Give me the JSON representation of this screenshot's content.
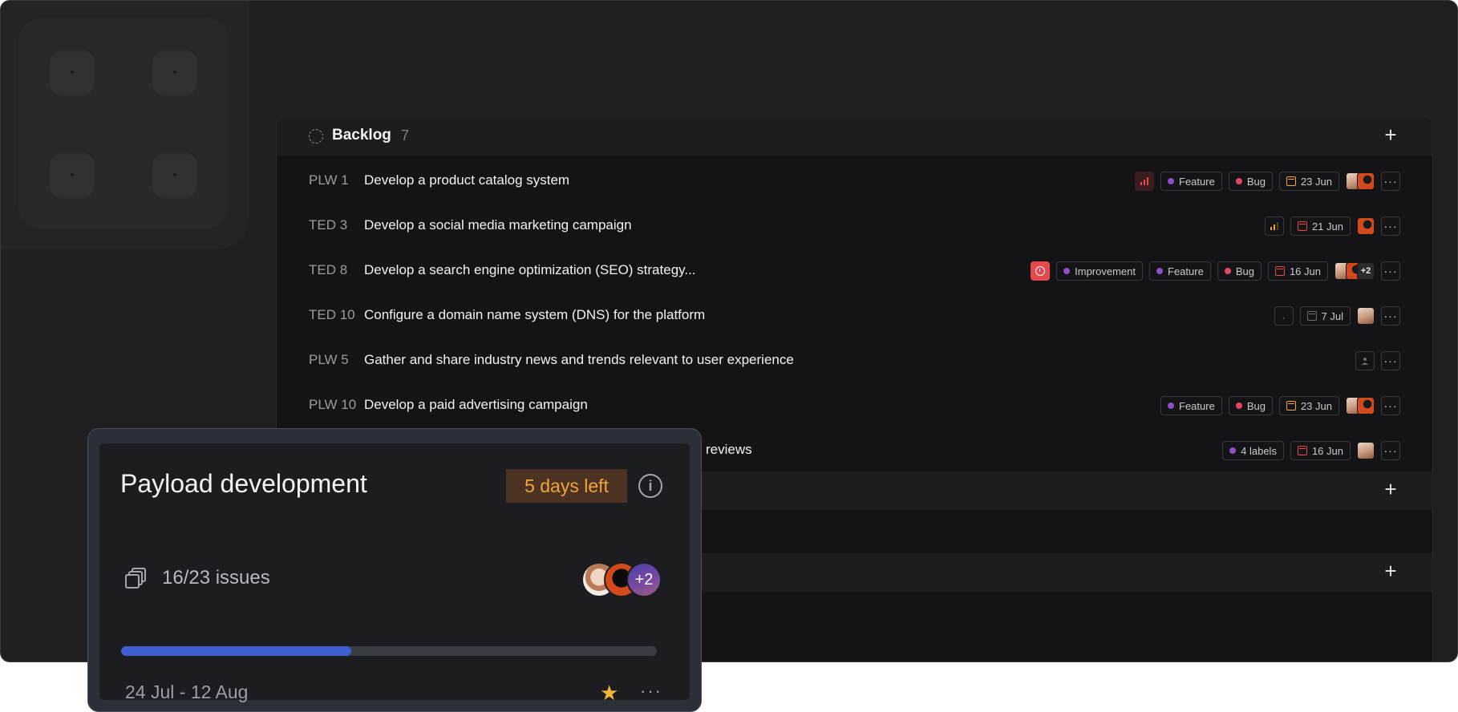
{
  "backlog_group": {
    "title": "Backlog",
    "count": "7"
  },
  "issues": [
    {
      "id": "PLW 1",
      "title": "Develop a product catalog system",
      "labels": [
        "Feature",
        "Bug"
      ],
      "date": "23 Jun"
    },
    {
      "id": "TED 3",
      "title": "Develop a social media marketing campaign",
      "labels": [],
      "date": "21 Jun"
    },
    {
      "id": "TED 8",
      "title": "Develop a search engine optimization (SEO) strategy...",
      "labels": [
        "Improvement",
        "Feature",
        "Bug"
      ],
      "date": "16 Jun",
      "extra_assignees": "+2"
    },
    {
      "id": "TED 10",
      "title": "Configure a domain name system (DNS) for the platform",
      "labels": [],
      "date": "7 Jul"
    },
    {
      "id": "PLW 5",
      "title": "Gather and share industry news and trends relevant to user experience",
      "labels": [],
      "date": ""
    },
    {
      "id": "PLW 10",
      "title": "Develop a paid advertising campaign",
      "labels": [
        "Feature",
        "Bug"
      ],
      "date": "23 Jun"
    },
    {
      "id": "",
      "title": "reviews",
      "labels": [
        "4 labels"
      ],
      "date": "16 Jun"
    }
  ],
  "label_colors": {
    "Feature": "#8e4ec6",
    "Bug": "#e54666",
    "Improvement": "#8e4ec6",
    "4 labels": "#8e4ec6"
  },
  "date_colors": {
    "overdue": "#e5484d",
    "soon": "#f2a33a",
    "future": "#8a8a90"
  },
  "group_add_icon": "plus-icon",
  "cycle_card": {
    "title": "Payload development",
    "days_left": "5 days left",
    "issues": "16/23 issues",
    "progress_percent": 43,
    "assignees_more": "+2",
    "dates": "24 Jul - 12 Aug",
    "favorite_icon": "star-icon",
    "more_icon": "ellipsis-icon",
    "info_icon": "info-icon"
  },
  "colors": {
    "accent_blue": "#3d5fcf",
    "badge_bg": "#4b3222",
    "badge_text": "#f2a33a"
  }
}
